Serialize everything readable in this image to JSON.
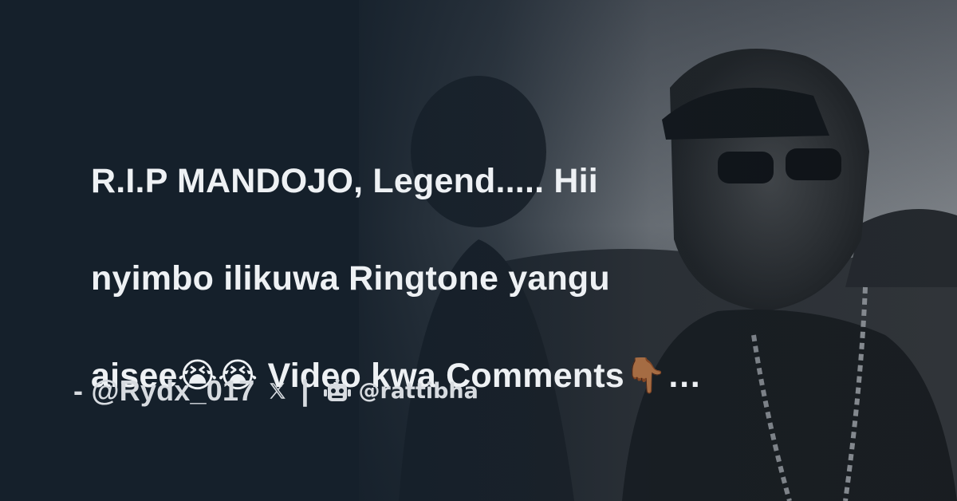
{
  "card": {
    "text_lines": [
      "R.I.P MANDOJO, Legend..... Hii",
      "nyimbo ilikuwa Ringtone yangu",
      "aisee😭😭 Video kwa Comments👇🏾…"
    ],
    "author": "- @Rydx_017",
    "x_icon": "x-logo-icon",
    "separator": "|",
    "bot_icon": "robot-icon",
    "brand_handle": "@rattibha"
  },
  "colors": {
    "background": "#15202b",
    "text": "#eef1f4",
    "footer_text": "#d7dbe0"
  }
}
